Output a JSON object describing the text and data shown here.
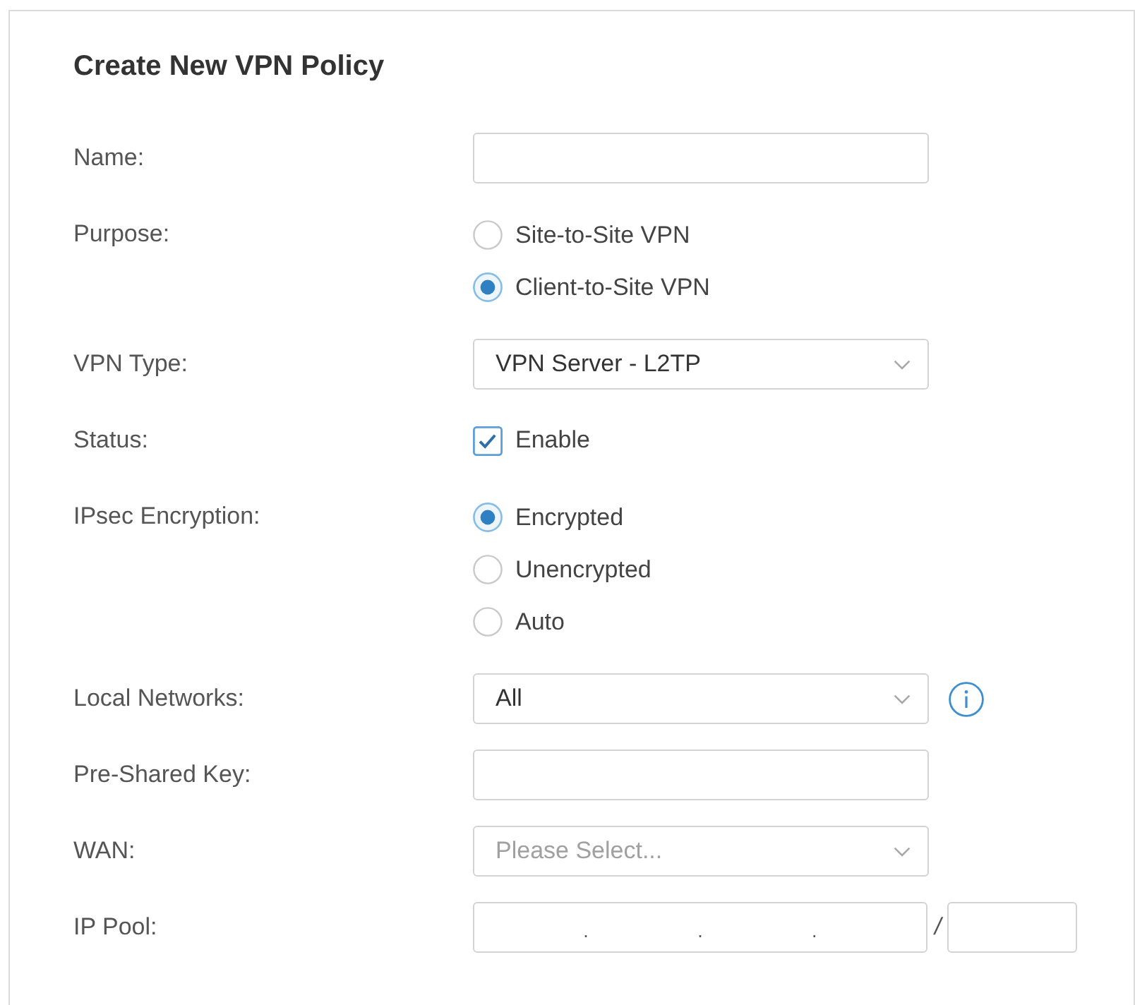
{
  "title": "Create New VPN Policy",
  "fields": [
    {
      "label": "Name:",
      "kind": "text"
    },
    {
      "label": "Purpose:",
      "kind": "radio",
      "options": [
        {
          "label": "Site-to-Site VPN",
          "selected": false
        },
        {
          "label": "Client-to-Site VPN",
          "selected": true
        }
      ]
    },
    {
      "label": "VPN Type:",
      "kind": "select",
      "value": "VPN Server - L2TP"
    },
    {
      "label": "Status:",
      "kind": "checkbox",
      "option": "Enable",
      "checked": true
    },
    {
      "label": "IPsec Encryption:",
      "kind": "radio",
      "options": [
        {
          "label": "Encrypted",
          "selected": true
        },
        {
          "label": "Unencrypted",
          "selected": false
        },
        {
          "label": "Auto",
          "selected": false
        }
      ]
    },
    {
      "label": "Local Networks:",
      "kind": "select",
      "value": "All",
      "info": true
    },
    {
      "label": "Pre-Shared Key:",
      "kind": "text"
    },
    {
      "label": "WAN:",
      "kind": "select",
      "placeholder": "Please Select..."
    },
    {
      "label": "IP Pool:",
      "kind": "ip",
      "octet_dots": [
        ".",
        ".",
        "."
      ],
      "separator": "/"
    }
  ]
}
